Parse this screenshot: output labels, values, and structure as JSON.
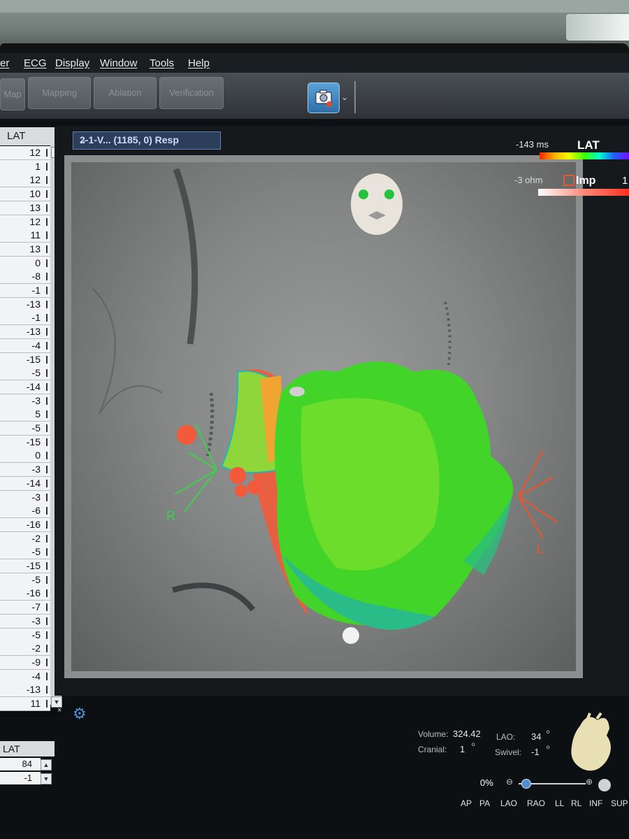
{
  "menu": {
    "items": [
      "er",
      "ECG",
      "Display",
      "Window",
      "Tools",
      "Help"
    ]
  },
  "toolbar": {
    "buttons": [
      "Map",
      "Mapping",
      "Ablation",
      "Verification"
    ]
  },
  "lat_list": {
    "header": "LAT",
    "values": [
      "12",
      "1",
      "12",
      "10",
      "13",
      "12",
      "11",
      "13",
      "0",
      "-8",
      "-1",
      "-13",
      "-1",
      "-13",
      "-4",
      "-15",
      "-5",
      "-14",
      "-3",
      "5",
      "-5",
      "-15",
      "0",
      "-3",
      "-14",
      "-3",
      "-6",
      "-16",
      "-2",
      "-5",
      "-15",
      "-5",
      "-16",
      "-7",
      "-3",
      "-5",
      "-2",
      "-9",
      "-4",
      "-13",
      "11"
    ]
  },
  "viewport": {
    "label": "2-1-V... (1185, 0) Resp",
    "marker_right": "R",
    "marker_left": "L"
  },
  "legend": {
    "lat_min": "-143 ms",
    "lat_title": "LAT",
    "imp_min": "-3 ohm",
    "imp_title": "Imp",
    "imp_max": "1"
  },
  "info": {
    "volume_label": "Volume:",
    "volume_value": "324.42",
    "cranial_label": "Cranial:",
    "cranial_value": "1",
    "cranial_unit": "º",
    "lao_label": "LAO:",
    "lao_value": "34",
    "lao_unit": "º",
    "swivel_label": "Swivel:",
    "swivel_value": "-1",
    "swivel_unit": "º",
    "zoom": "0%"
  },
  "view_buttons": [
    "AP",
    "PA",
    "LAO",
    "RAO",
    "LL",
    "RL",
    "INF",
    "SUP"
  ],
  "lat_list_2": {
    "header": "LAT",
    "values": [
      "84",
      "-1"
    ]
  },
  "colors": {
    "accent_blue": "#2e6fa8",
    "map_green": "#43d42a",
    "catheter_orange": "#f25a3a",
    "r_marker": "#3fd04a",
    "l_marker": "#f0532a"
  }
}
